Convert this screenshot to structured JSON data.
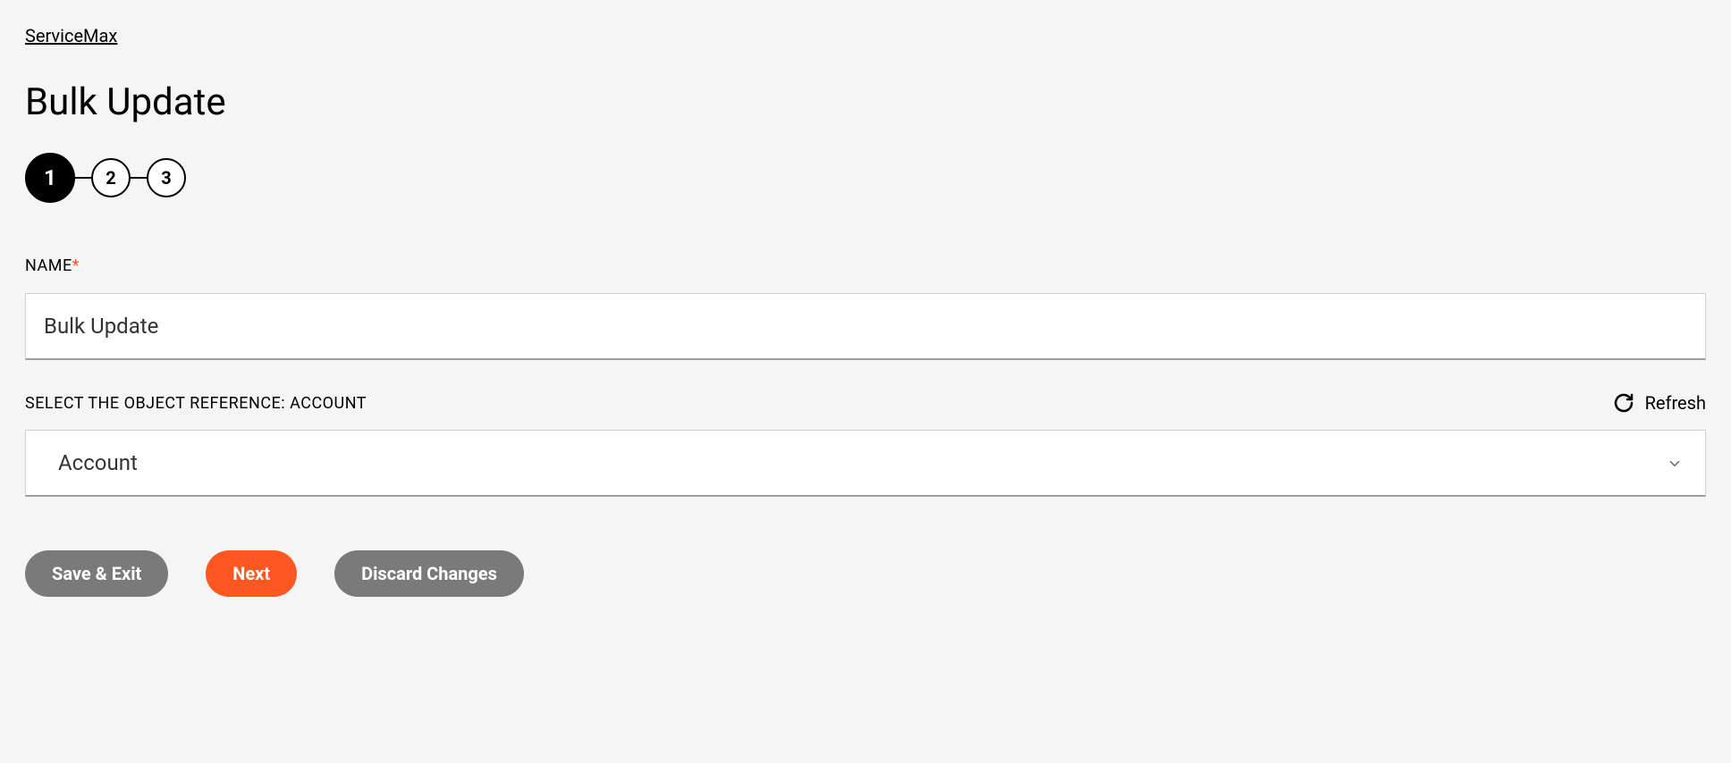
{
  "breadcrumb": "ServiceMax",
  "page_title": "Bulk Update",
  "stepper": {
    "steps": [
      "1",
      "2",
      "3"
    ],
    "active_index": 0
  },
  "fields": {
    "name": {
      "label": "NAME",
      "required_marker": "*",
      "value": "Bulk Update"
    },
    "object_reference": {
      "label": "SELECT THE OBJECT REFERENCE: ACCOUNT",
      "value": "Account",
      "refresh_label": "Refresh"
    }
  },
  "buttons": {
    "save_exit": "Save & Exit",
    "next": "Next",
    "discard": "Discard Changes"
  }
}
